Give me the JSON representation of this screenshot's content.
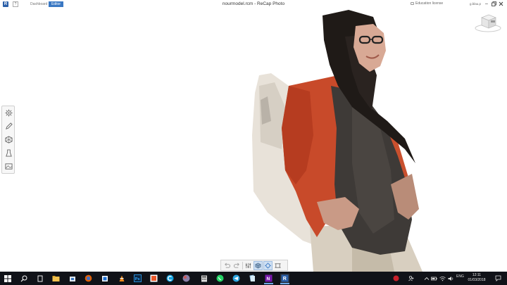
{
  "titlebar": {
    "app_logo": "R",
    "help": "?",
    "nav_dashboard": "Dashboard",
    "nav_editor": "Editor",
    "title": "nourmodel.rcm - ReCap Photo",
    "license": "Education license",
    "user": "g.blau.p"
  },
  "left_toolbar": {
    "items": [
      "settings-icon",
      "pencil-icon",
      "hexagon-icon",
      "tools-icon",
      "image-icon"
    ]
  },
  "bottom_toolbar": {
    "items": [
      "undo-icon",
      "redo-icon",
      "sliders-icon",
      "cube-icon",
      "orbit-icon",
      "crop-icon"
    ]
  },
  "taskbar": {
    "language": "ENG",
    "time": "12:11",
    "date": "01/03/2018"
  },
  "colors": {
    "accent": "#3a78c3",
    "taskbar": "#101218",
    "jacket": "#c84a2a"
  }
}
